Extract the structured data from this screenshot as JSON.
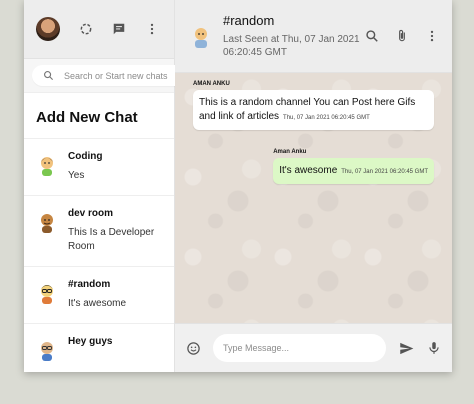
{
  "sidebar": {
    "search_placeholder": "Search or Start new chats",
    "add_new_chat": "Add New Chat",
    "chats": [
      {
        "name": "Coding",
        "last": "Yes",
        "avatar_color": "#f1c27d"
      },
      {
        "name": "dev room",
        "last": "This Is a Developer Room",
        "avatar_color": "#c68642"
      },
      {
        "name": "#random",
        "last": "It's awesome",
        "avatar_color": "#f3d27b"
      },
      {
        "name": "Hey guys",
        "last": "",
        "avatar_color": "#e0b68a"
      }
    ]
  },
  "room": {
    "name": "#random",
    "last_seen": "Last Seen at Thu, 07 Jan 2021 06:20:45 GMT"
  },
  "messages": [
    {
      "sender": "AMAN ANKU",
      "text": "This is a random channel You can Post here Gifs and link of articles",
      "time": "Thu, 07 Jan 2021 06:20:45 GMT",
      "direction": "in"
    },
    {
      "sender": "Aman Anku",
      "text": "It's awesome",
      "time": "Thu, 07 Jan 2021 06:20:45 GMT",
      "direction": "out"
    }
  ],
  "footer": {
    "input_placeholder": "Type Message..."
  },
  "colors": {
    "outgoing_bubble": "#dcf8c6",
    "incoming_bubble": "#ffffff",
    "chat_background": "#e5ddd5"
  },
  "icons": [
    "status-icon",
    "new-chat-icon",
    "more-vert-icon",
    "search-icon",
    "attach-icon",
    "emoji-icon",
    "send-icon",
    "mic-icon"
  ]
}
